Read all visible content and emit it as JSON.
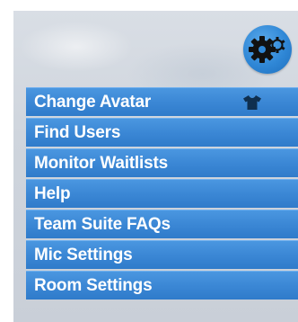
{
  "settings_button": {
    "icon": "gears-icon",
    "accent_color": "#2f87d6"
  },
  "menu": {
    "items": [
      {
        "label": "Change Avatar",
        "icon": "shirt-icon"
      },
      {
        "label": "Find Users"
      },
      {
        "label": "Monitor Waitlists"
      },
      {
        "label": "Help"
      },
      {
        "label": "Team Suite FAQs"
      },
      {
        "label": "Mic Settings"
      },
      {
        "label": "Room Settings"
      }
    ],
    "item_color": "#3a86d4",
    "text_color": "#ffffff"
  }
}
